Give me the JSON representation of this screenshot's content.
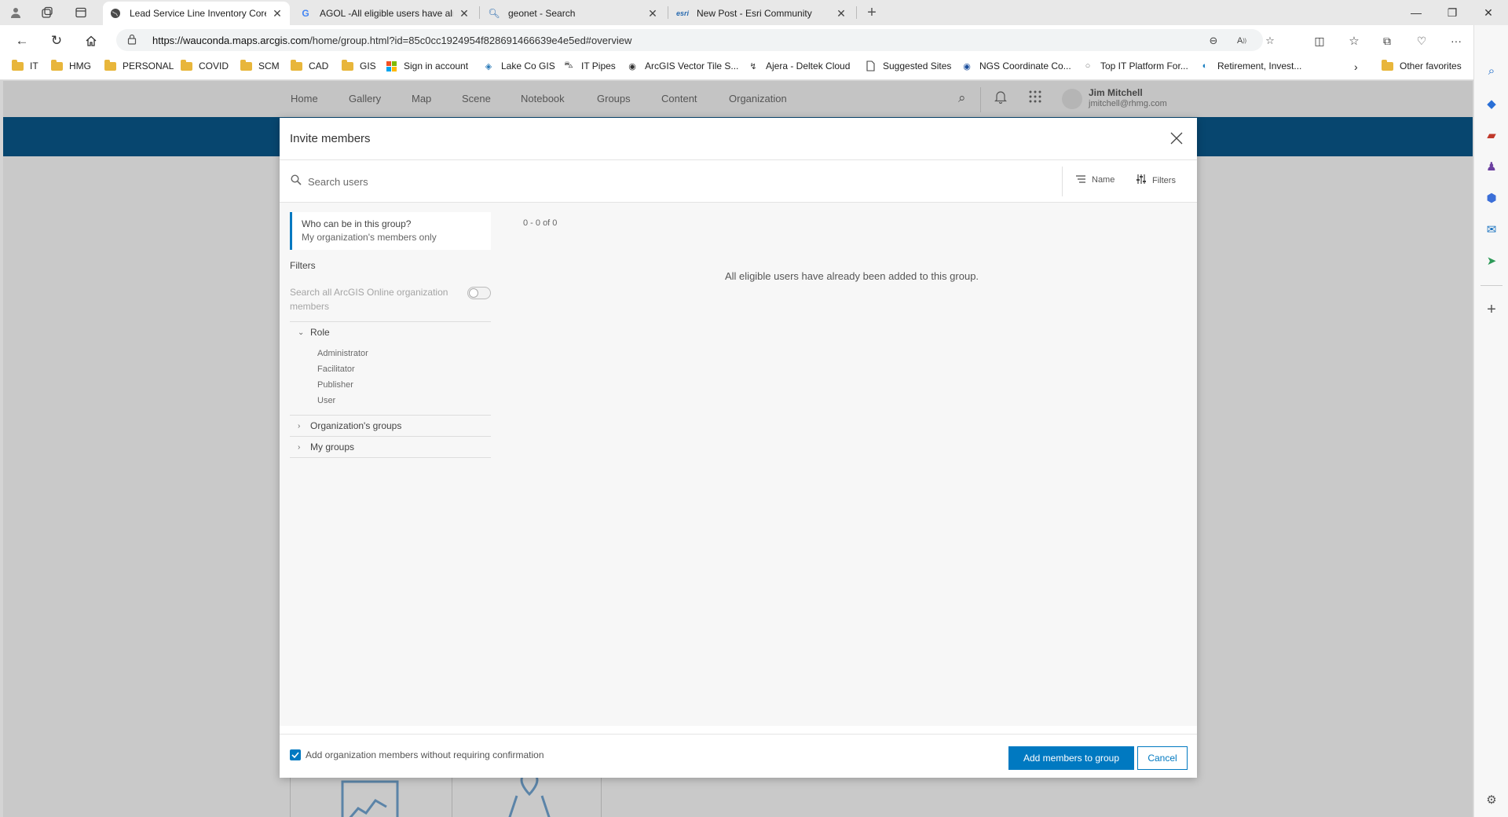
{
  "browser": {
    "tabs": [
      {
        "title": "Lead Service Line Inventory Core",
        "icon": "globe-icon",
        "active": true
      },
      {
        "title": "AGOL -All eligible users have alre",
        "icon": "google-icon",
        "active": false
      },
      {
        "title": "geonet - Search",
        "icon": "search-icon",
        "active": false
      },
      {
        "title": "New Post - Esri Community",
        "icon": "esri-icon",
        "active": false
      }
    ],
    "url_host": "https://wauconda.maps.arcgis.com",
    "url_path": "/home/group.html?id=85c0cc1924954f828691466639e4e5ed#overview",
    "bookmarks": [
      {
        "label": "IT",
        "icon": "folder-icon"
      },
      {
        "label": "HMG",
        "icon": "folder-icon"
      },
      {
        "label": "PERSONAL",
        "icon": "folder-icon"
      },
      {
        "label": "COVID",
        "icon": "folder-icon"
      },
      {
        "label": "SCM",
        "icon": "folder-icon"
      },
      {
        "label": "CAD",
        "icon": "folder-icon"
      },
      {
        "label": "GIS",
        "icon": "folder-icon"
      },
      {
        "label": "Sign in account",
        "icon": "microsoft-icon"
      },
      {
        "label": "Lake Co GIS",
        "icon": "lake-co-icon"
      },
      {
        "label": "IT Pipes",
        "icon": "it-pipes-icon"
      },
      {
        "label": "ArcGIS Vector Tile S...",
        "icon": "globe-icon"
      },
      {
        "label": "Ajera - Deltek Cloud",
        "icon": "deltek-icon"
      },
      {
        "label": "Suggested Sites",
        "icon": "page-icon"
      },
      {
        "label": "NGS Coordinate Co...",
        "icon": "noaa-icon"
      },
      {
        "label": "Top IT Platform For...",
        "icon": "circle-icon"
      },
      {
        "label": "Retirement, Invest...",
        "icon": "fidelity-icon"
      }
    ],
    "other_favorites": "Other favorites"
  },
  "agol": {
    "nav": [
      "Home",
      "Gallery",
      "Map",
      "Scene",
      "Notebook",
      "Groups",
      "Content",
      "Organization"
    ],
    "user_name": "Jim Mitchell",
    "user_email": "jmitchell@rhmg.com"
  },
  "modal": {
    "title": "Invite members",
    "search_placeholder": "Search users",
    "sort_label": "Name",
    "filters_label": "Filters",
    "who_question": "Who can be in this group?",
    "who_answer": "My organization's members only",
    "filters_heading": "Filters",
    "toggle_label": "Search all ArcGIS Online organization members",
    "role_heading": "Role",
    "roles": [
      "Administrator",
      "Facilitator",
      "Publisher",
      "User"
    ],
    "org_groups_heading": "Organization's groups",
    "my_groups_heading": "My groups",
    "results_count": "0 - 0 of 0",
    "empty_message": "All eligible users have already been added to this group.",
    "checkbox_label": "Add organization members without requiring confirmation",
    "checkbox_checked": true,
    "add_button": "Add members to group",
    "cancel_button": "Cancel"
  },
  "colors": {
    "accent": "#0079c1",
    "banner": "#07466f"
  }
}
